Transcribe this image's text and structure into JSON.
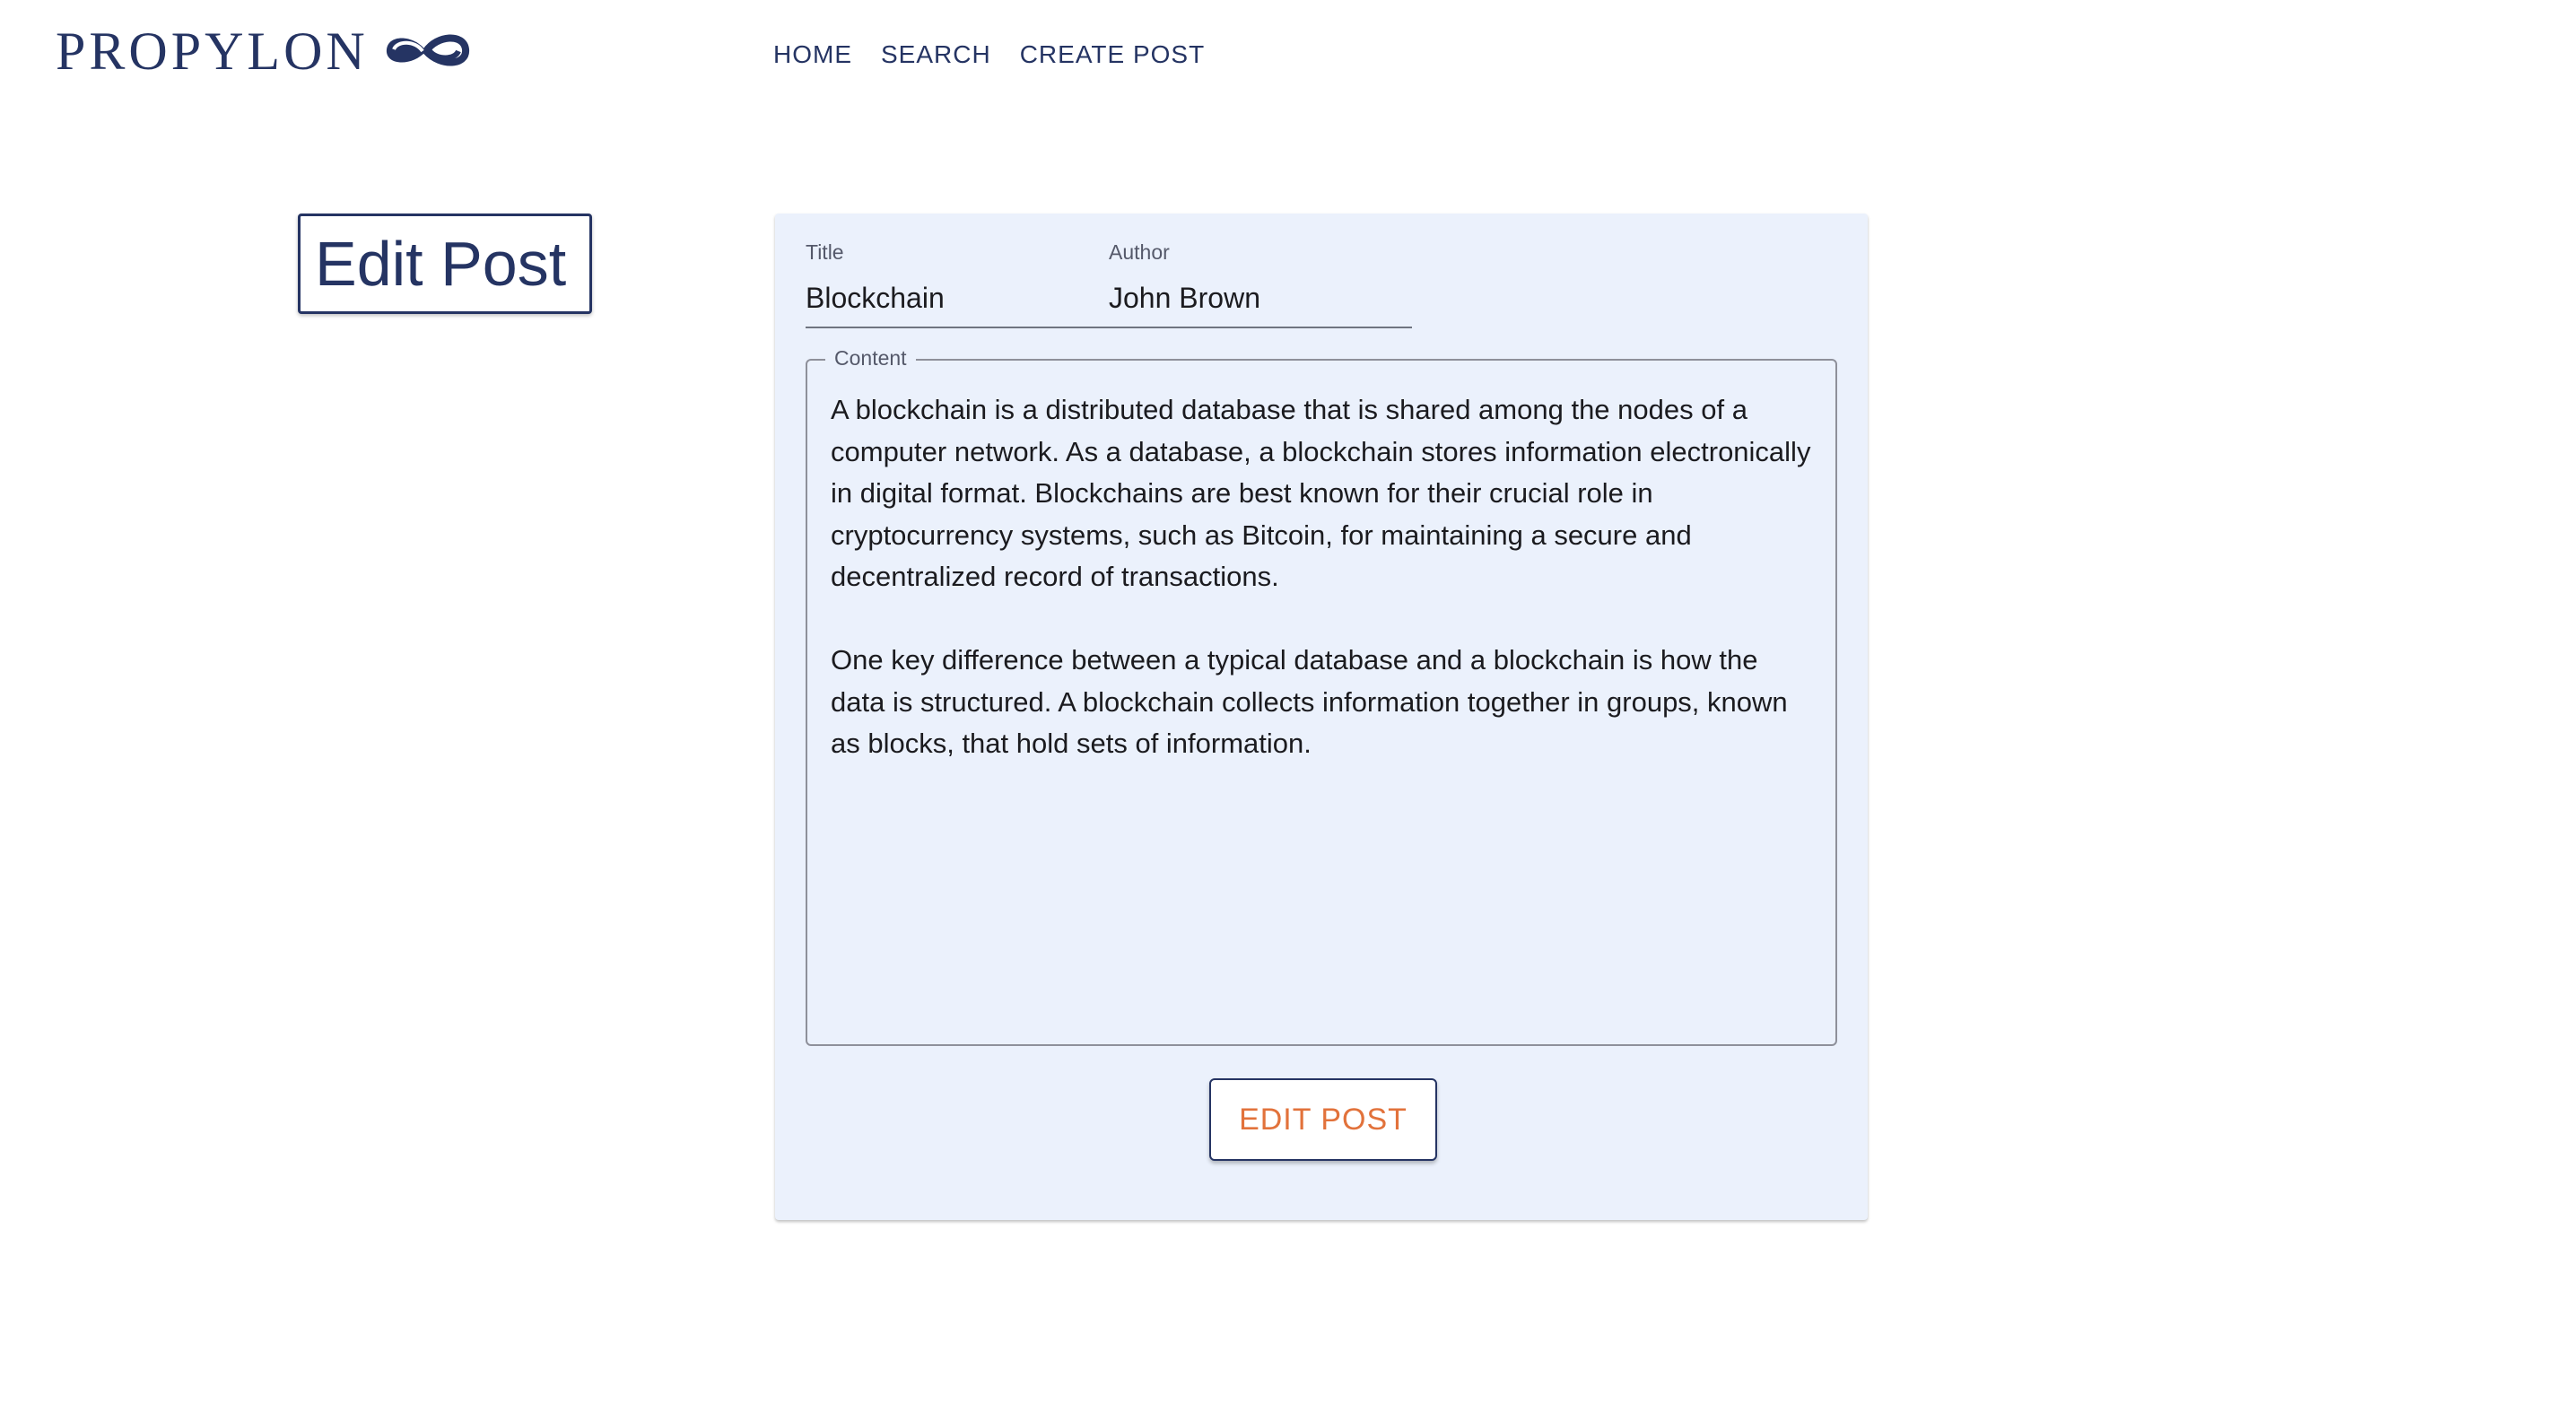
{
  "brand": {
    "name": "PROPYLON",
    "logo_icon": "infinity-knot-icon",
    "color": "#253463"
  },
  "nav": {
    "items": [
      {
        "label": "HOME"
      },
      {
        "label": "SEARCH"
      },
      {
        "label": "CREATE POST"
      }
    ]
  },
  "page": {
    "heading": "Edit Post"
  },
  "form": {
    "title": {
      "label": "Title",
      "value": "Blockchain"
    },
    "author": {
      "label": "Author",
      "value": "John Brown"
    },
    "content": {
      "label": "Content",
      "value": "A blockchain is a distributed database that is shared among the nodes of a computer network. As a database, a blockchain stores information electronically in digital format. Blockchains are best known for their crucial role in cryptocurrency systems, such as Bitcoin, for maintaining a secure and decentralized record of transactions.\n\nOne key difference between a typical database and a blockchain is how the data is structured. A blockchain collects information together in groups, known as blocks, that hold sets of information."
    },
    "submit_label": "EDIT POST"
  },
  "colors": {
    "card_background": "#ebf1fc",
    "accent": "#e2723b",
    "primary": "#253463"
  }
}
